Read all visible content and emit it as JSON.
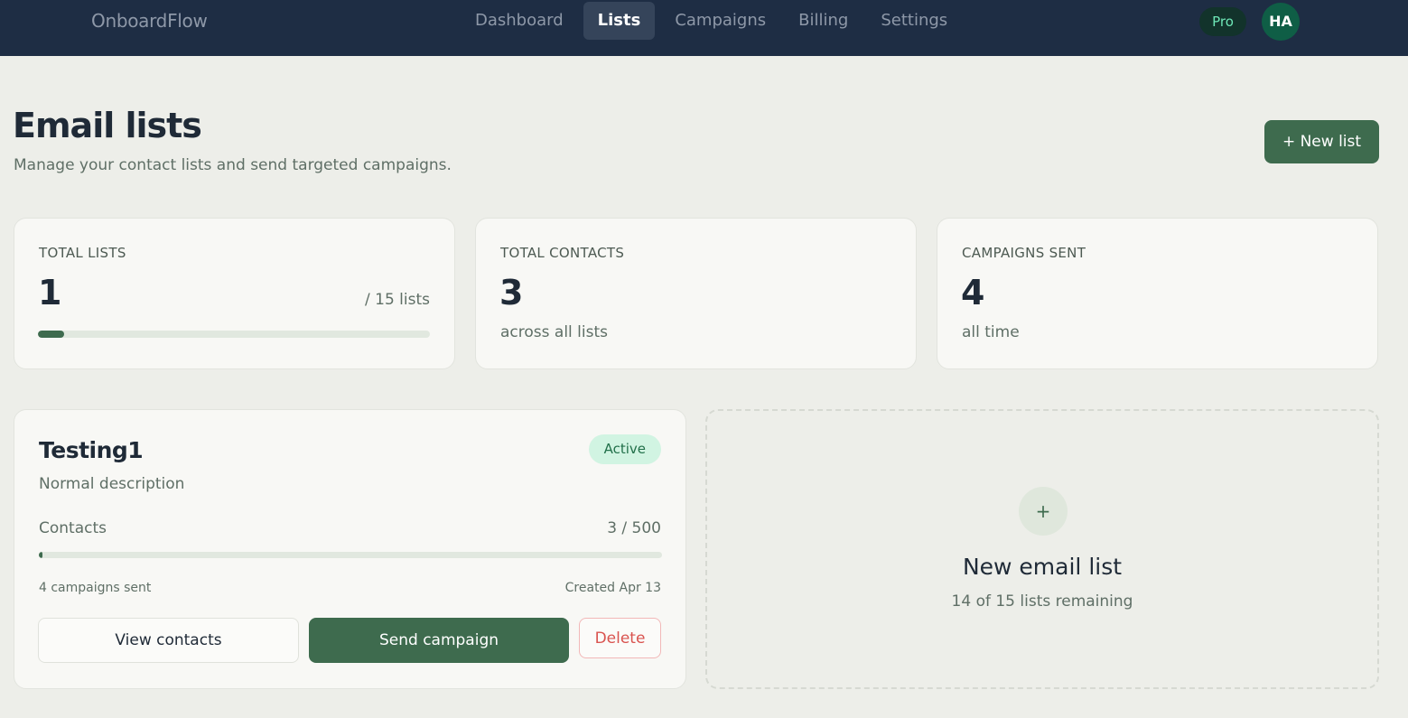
{
  "app": {
    "brand": "OnboardFlow",
    "nav": [
      {
        "label": "Dashboard",
        "active": false
      },
      {
        "label": "Lists",
        "active": true
      },
      {
        "label": "Campaigns",
        "active": false
      },
      {
        "label": "Billing",
        "active": false
      },
      {
        "label": "Settings",
        "active": false
      }
    ],
    "plan_badge": "Pro",
    "avatar_initials": "HA"
  },
  "header": {
    "title": "Email lists",
    "subtitle": "Manage your contact lists and send targeted campaigns.",
    "new_list_button": "+ New list"
  },
  "stats": {
    "total_lists": {
      "label": "TOTAL LISTS",
      "value": "1",
      "aside": "/ 15 lists",
      "progress_fraction": 0.0667
    },
    "total_contacts": {
      "label": "TOTAL CONTACTS",
      "value": "3",
      "sub": "across all lists"
    },
    "campaigns_sent": {
      "label": "CAMPAIGNS SENT",
      "value": "4",
      "sub": "all time"
    }
  },
  "lists": [
    {
      "name": "Testing1",
      "status": "Active",
      "description": "Normal description",
      "contacts_label": "Contacts",
      "contacts_value": "3 / 500",
      "contacts_fraction": 0.006,
      "campaigns_sent": "4 campaigns sent",
      "created": "Created Apr 13",
      "buttons": {
        "view": "View contacts",
        "send": "Send campaign",
        "delete": "Delete"
      }
    }
  ],
  "new_list_card": {
    "plus": "+",
    "title": "New email list",
    "subtitle": "14 of 15 lists remaining"
  },
  "colors": {
    "nav_bg": "#1e2d44",
    "accent": "#3e6b4e",
    "active_badge_bg": "#d1f4e2",
    "delete": "#d9534f"
  },
  "icons": {
    "plus": "plus-icon"
  }
}
